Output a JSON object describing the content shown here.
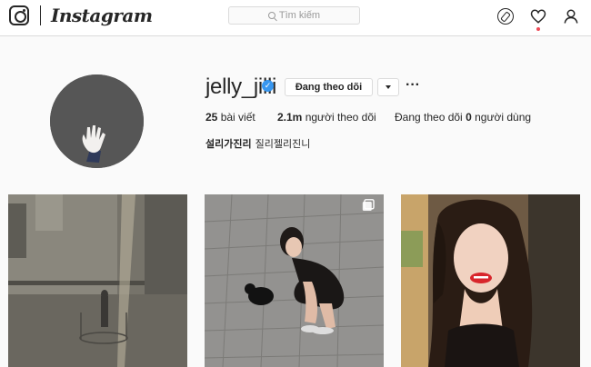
{
  "header": {
    "brand": "Instagram",
    "search_placeholder": "Tìm kiếm"
  },
  "profile": {
    "username": "jelly_jilli",
    "follow_button": "Đang theo dõi",
    "stats": {
      "posts_count": "25",
      "posts_label": "bài viết",
      "followers_count": "2.1m",
      "followers_label": "người theo dõi",
      "following_prefix": "Đang theo dõi",
      "following_count": "0",
      "following_label": "người dùng"
    },
    "bio": {
      "name": "설리가진리",
      "text": "질리젤리진니"
    }
  },
  "grid": {
    "posts": [
      {
        "icon": "photo"
      },
      {
        "icon": "multi-photo"
      },
      {
        "icon": "photo"
      }
    ]
  },
  "colors": {
    "verified": "#3897f0",
    "notification_dot": "#ed4956",
    "border": "#dbdbdb"
  }
}
